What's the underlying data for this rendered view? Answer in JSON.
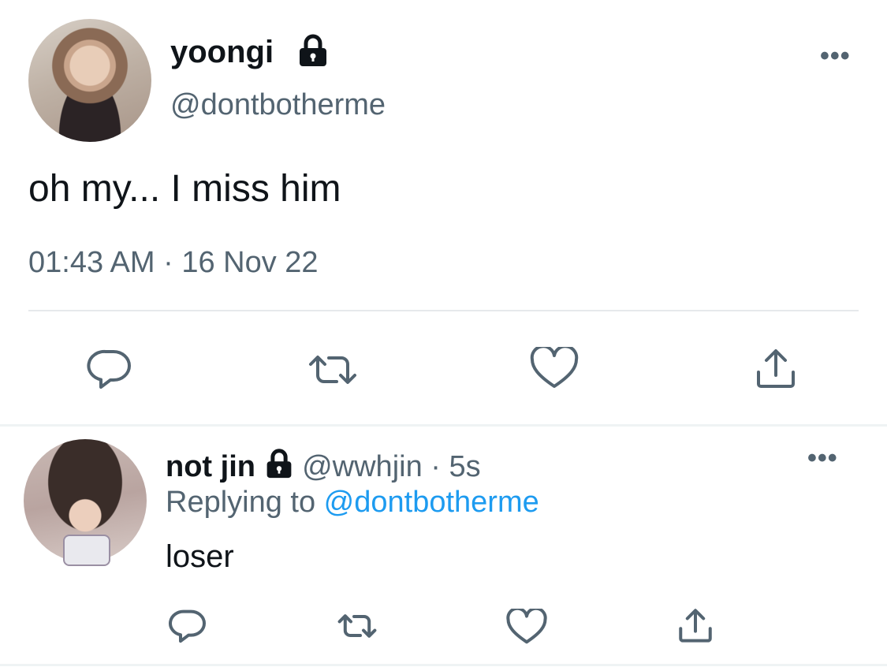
{
  "main_tweet": {
    "display_name": "yoongi",
    "handle": "@dontbotherme",
    "text": "oh my... I miss him",
    "time": "01:43 AM",
    "separator": " · ",
    "date": "16 Nov 22",
    "more": "•••",
    "avatar_icon": "profile-photo",
    "protected_icon": "lock-icon"
  },
  "reply_tweet": {
    "display_name": "not jin",
    "handle": "@wwhjin",
    "age": "5s",
    "separator": " · ",
    "replying_label": "Replying to ",
    "replying_handle": "@dontbotherme",
    "text": "loser",
    "more": "•••",
    "avatar_icon": "profile-photo",
    "protected_icon": "lock-icon"
  },
  "actions": [
    "reply-icon",
    "retweet-icon",
    "like-icon",
    "share-icon"
  ],
  "colors": {
    "text": "#0f1419",
    "secondary": "#536471",
    "link": "#1d9bf0",
    "divider": "#eff3f4"
  }
}
